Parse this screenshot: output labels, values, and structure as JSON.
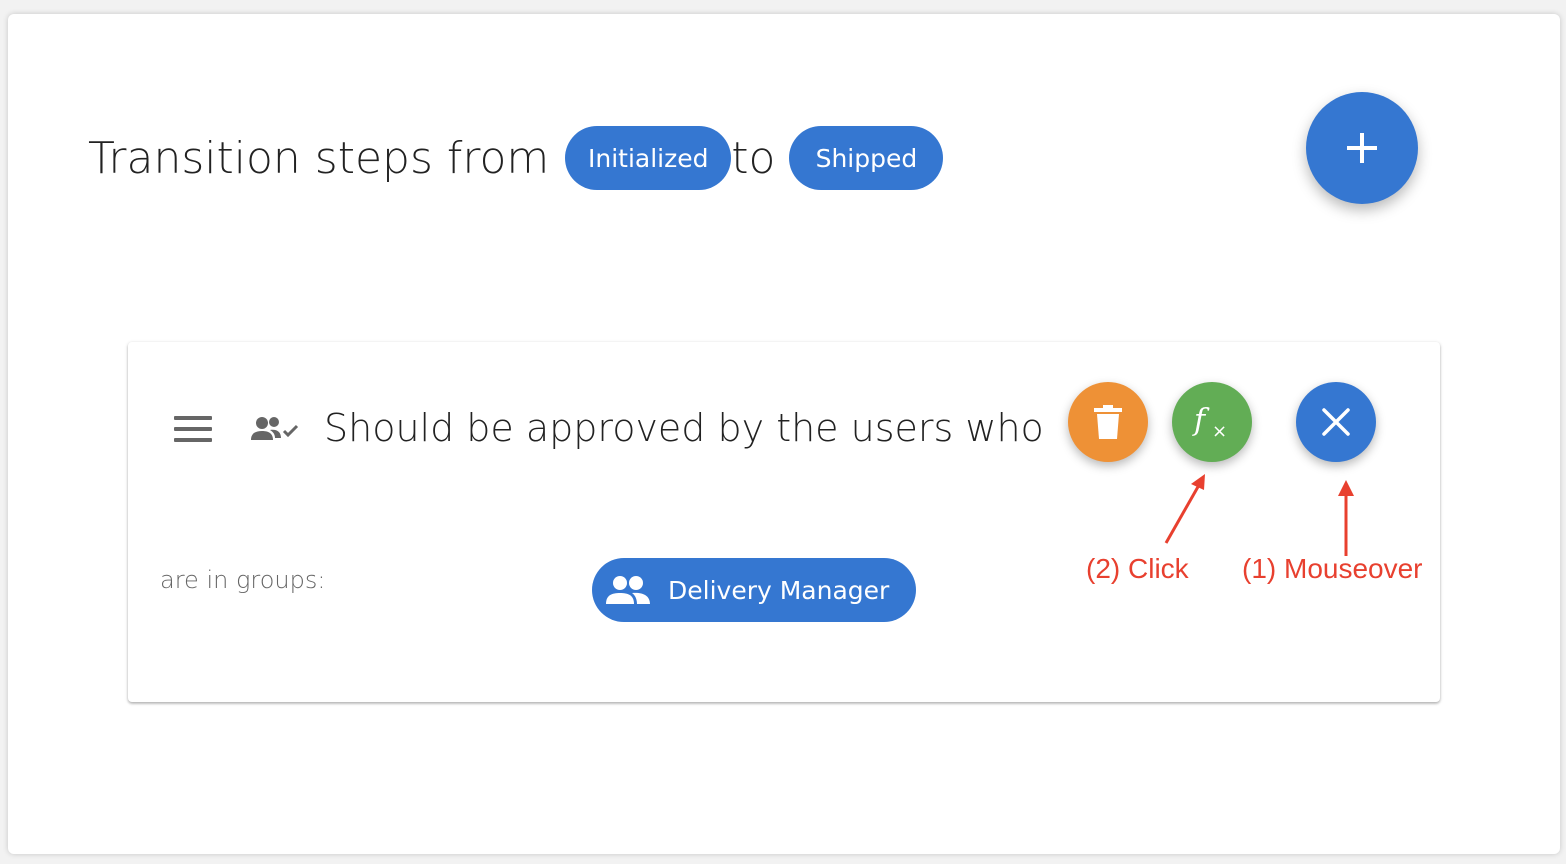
{
  "header": {
    "title_prefix": "Transition steps from",
    "from_state": "Initialized",
    "connector": "to",
    "to_state": "Shipped"
  },
  "add_button": {
    "icon": "plus-icon"
  },
  "step_card": {
    "drag_icon": "menu-icon",
    "type_icon": "group-check-icon",
    "text": "Should be approved by the users who",
    "actions": {
      "delete_icon": "trash-icon",
      "formula_icon": "function-fx-icon",
      "close_icon": "close-icon"
    },
    "groups_label": "are in groups:",
    "group_chip": {
      "icon": "people-icon",
      "label": "Delivery Manager"
    }
  },
  "annotations": {
    "click_label": "(2) Click",
    "mouseover_label": "(1) Mouseover"
  },
  "colors": {
    "primary": "#3577d1",
    "delete": "#ee9136",
    "formula": "#62ad55",
    "annotation": "#e8402f"
  }
}
